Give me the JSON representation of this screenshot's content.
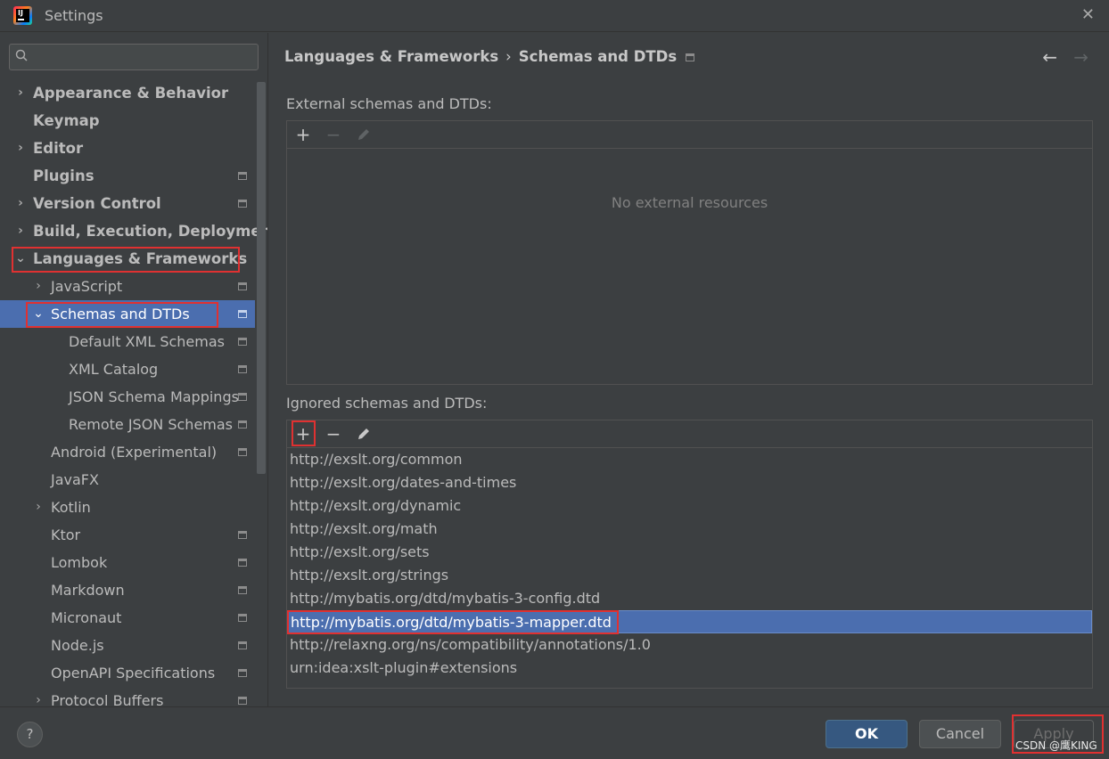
{
  "window": {
    "title": "Settings",
    "close_glyph": "✕"
  },
  "sidebar": {
    "search_placeholder": "",
    "items": [
      {
        "label": "Appearance & Behavior",
        "chevron": "›",
        "pinned": false
      },
      {
        "label": "Keymap",
        "chevron": "",
        "pinned": false
      },
      {
        "label": "Editor",
        "chevron": "›",
        "pinned": false
      },
      {
        "label": "Plugins",
        "chevron": "",
        "pinned": true
      },
      {
        "label": "Version Control",
        "chevron": "›",
        "pinned": true
      },
      {
        "label": "Build, Execution, Deployment",
        "chevron": "›",
        "pinned": false
      },
      {
        "label": "Languages & Frameworks",
        "chevron": "⌄",
        "pinned": false
      },
      {
        "label": "JavaScript",
        "chevron": "›",
        "pinned": true
      },
      {
        "label": "Schemas and DTDs",
        "chevron": "⌄",
        "pinned": true,
        "selected": true
      },
      {
        "label": "Default XML Schemas",
        "chevron": "",
        "pinned": true
      },
      {
        "label": "XML Catalog",
        "chevron": "",
        "pinned": true
      },
      {
        "label": "JSON Schema Mappings",
        "chevron": "",
        "pinned": true
      },
      {
        "label": "Remote JSON Schemas",
        "chevron": "",
        "pinned": true
      },
      {
        "label": "Android (Experimental)",
        "chevron": "",
        "pinned": true
      },
      {
        "label": "JavaFX",
        "chevron": "",
        "pinned": false
      },
      {
        "label": "Kotlin",
        "chevron": "›",
        "pinned": false
      },
      {
        "label": "Ktor",
        "chevron": "",
        "pinned": true
      },
      {
        "label": "Lombok",
        "chevron": "",
        "pinned": true
      },
      {
        "label": "Markdown",
        "chevron": "",
        "pinned": true
      },
      {
        "label": "Micronaut",
        "chevron": "",
        "pinned": true
      },
      {
        "label": "Node.js",
        "chevron": "",
        "pinned": true
      },
      {
        "label": "OpenAPI Specifications",
        "chevron": "",
        "pinned": true
      },
      {
        "label": "Protocol Buffers",
        "chevron": "›",
        "pinned": true
      }
    ]
  },
  "breadcrumb": {
    "parent": "Languages & Frameworks",
    "separator": "›",
    "current": "Schemas and DTDs",
    "back_glyph": "←",
    "forward_glyph": "→"
  },
  "external": {
    "label": "External schemas and DTDs:",
    "add": "+",
    "remove": "−",
    "empty_text": "No external resources"
  },
  "ignored": {
    "label": "Ignored schemas and DTDs:",
    "add": "+",
    "remove": "−",
    "items": [
      "http://exslt.org/common",
      "http://exslt.org/dates-and-times",
      "http://exslt.org/dynamic",
      "http://exslt.org/math",
      "http://exslt.org/sets",
      "http://exslt.org/strings",
      "http://mybatis.org/dtd/mybatis-3-config.dtd",
      "http://mybatis.org/dtd/mybatis-3-mapper.dtd",
      "http://relaxng.org/ns/compatibility/annotations/1.0",
      "urn:idea:xslt-plugin#extensions"
    ],
    "selected_item": "http://mybatis.org/dtd/mybatis-3-mapper.dtd"
  },
  "footer": {
    "help": "?",
    "ok": "OK",
    "cancel": "Cancel",
    "apply": "Apply",
    "watermark": "CSDN @鹰KING"
  },
  "colors": {
    "background": "#3c3f41",
    "selection": "#4b6eaf",
    "ok_button": "#365880",
    "highlight_box": "#e03131"
  }
}
